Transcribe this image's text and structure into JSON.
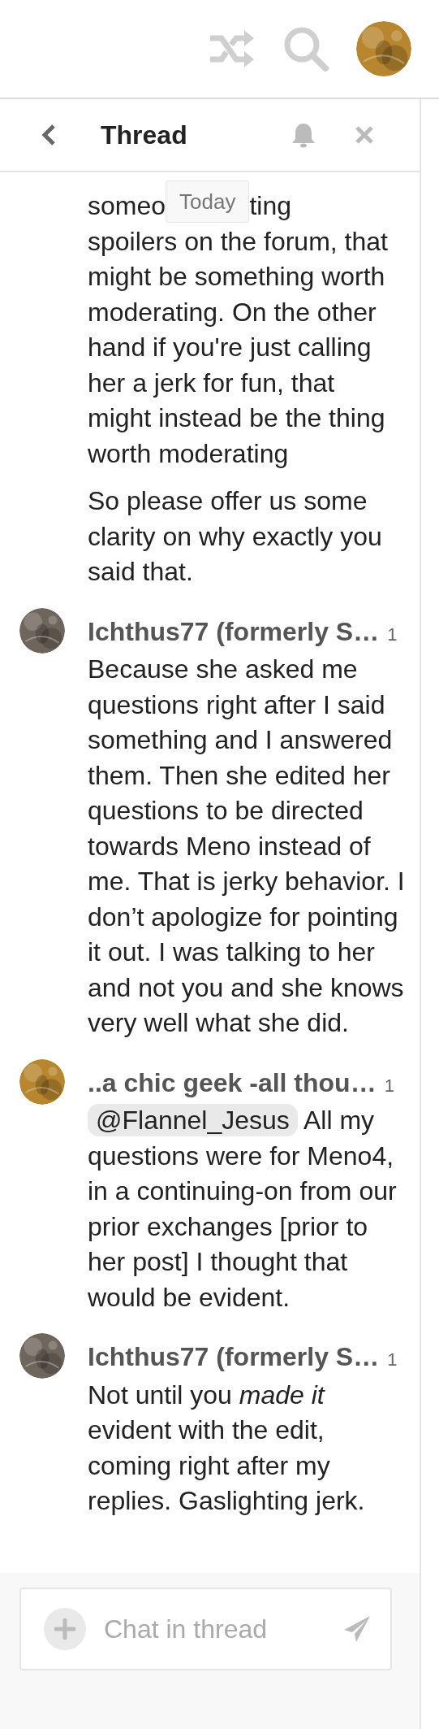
{
  "top_bar": {
    "avatar": {
      "kind": "picture",
      "color": "#b8862e"
    }
  },
  "thread_header": {
    "title": "Thread"
  },
  "top_message": {
    "covered_line": {
      "before": "someo",
      "tooltip": "Today",
      "after": "ting"
    },
    "paragraphs": [
      "spoilers on the forum, that might be something worth moderating. On the other hand if you're just calling her a jerk for fun, that might instead be the thing worth moderating",
      "So please offer us some clarity on why exactly you said that."
    ]
  },
  "messages": [
    {
      "username": "Ichthus77 (formerly S…",
      "count": "1",
      "avatar": {
        "kind": "picture",
        "color": "#6e655c"
      },
      "body": [
        {
          "kind": "text",
          "text": "Because she asked me questions right after I said something and I answered them. Then she edited her questions to be directed towards Meno instead of me. That is jerky behavior. I don’t apologize for pointing it out. I was talking to her and not you and she knows very well what she did."
        }
      ]
    },
    {
      "username": "..a chic geek -all thou…",
      "count": "1",
      "avatar": {
        "kind": "picture",
        "color": "#b8862e"
      },
      "body": [
        {
          "kind": "mention",
          "text": "@Flannel_Jesus"
        },
        {
          "kind": "text",
          "text": " All my questions were for Meno4, in a continuing-on from our prior exchanges [prior to her post] I thought that would be evident."
        }
      ]
    },
    {
      "username": "Ichthus77 (formerly S…",
      "count": "1",
      "avatar": {
        "kind": "picture",
        "color": "#6e655c"
      },
      "body": [
        {
          "kind": "text",
          "text": "Not until you *made it* evident with the edit, coming right after my replies. Gaslighting jerk."
        }
      ]
    }
  ],
  "composer": {
    "placeholder": "Chat in thread"
  }
}
